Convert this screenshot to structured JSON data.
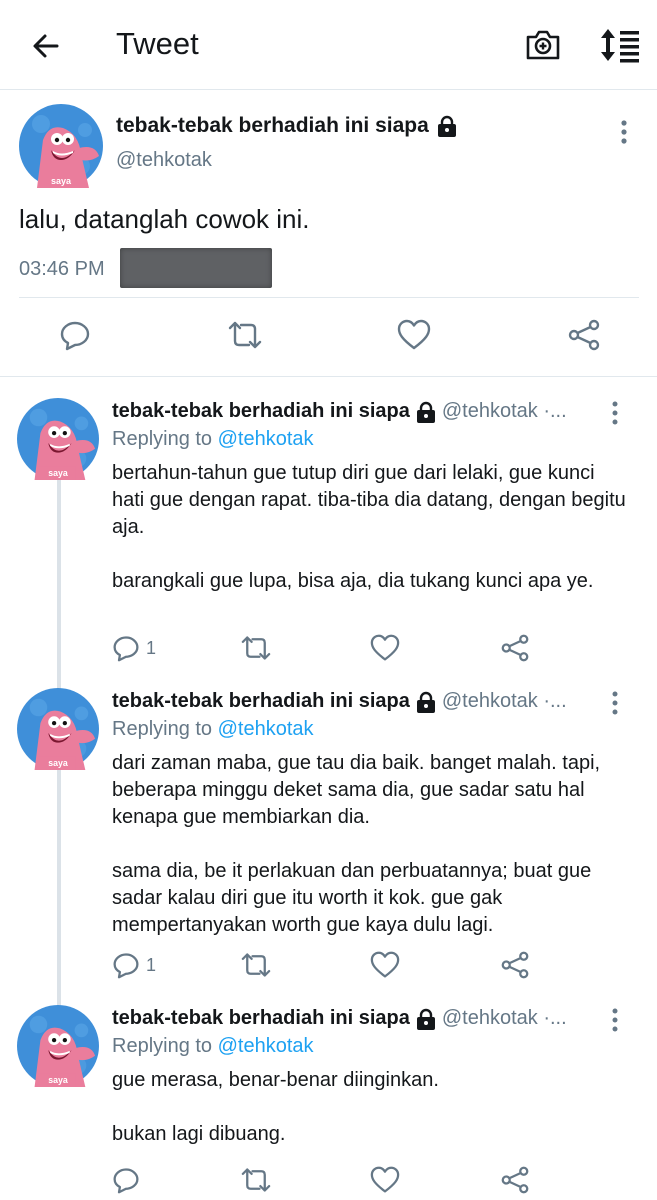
{
  "header": {
    "title": "Tweet",
    "back_icon": "arrow-left-icon",
    "camera_icon": "camera-plus-icon",
    "sort_icon": "sort-list-icon"
  },
  "main_tweet": {
    "display_name": "tebak-tebak berhadiah ini siapa",
    "handle": "@tehkotak",
    "text": "lalu, datanglah cowok ini.",
    "time": "03:46 PM",
    "avatar_caption": "saya"
  },
  "replies": [
    {
      "display_name": "tebak-tebak berhadiah ini siapa",
      "handle": "@tehkotak ·...",
      "replying_prefix": "Replying to",
      "replying_to": "@tehkotak",
      "avatar_caption": "saya",
      "paragraphs": [
        "bertahun-tahun gue tutup diri gue dari lelaki, gue kunci hati gue dengan rapat. tiba-tiba dia datang, dengan begitu aja.",
        "barangkali gue lupa, bisa aja, dia tukang kunci apa ye."
      ],
      "reply_count": "1"
    },
    {
      "display_name": "tebak-tebak berhadiah ini siapa",
      "handle": "@tehkotak ·...",
      "replying_prefix": "Replying to",
      "replying_to": "@tehkotak",
      "avatar_caption": "saya",
      "paragraphs": [
        "dari zaman maba, gue tau dia baik. banget malah. tapi, beberapa minggu deket sama dia, gue sadar satu hal kenapa gue membiarkan dia.",
        "sama dia, be it perlakuan dan perbuatannya; buat gue sadar kalau diri gue itu worth it kok. gue gak mempertanyakan worth gue kaya dulu lagi."
      ],
      "reply_count": "1"
    },
    {
      "display_name": "tebak-tebak berhadiah ini siapa",
      "handle": "@tehkotak ·...",
      "replying_prefix": "Replying to",
      "replying_to": "@tehkotak",
      "avatar_caption": "saya",
      "paragraphs": [
        "gue merasa, benar-benar diinginkan.",
        "bukan lagi dibuang."
      ],
      "reply_count": ""
    }
  ],
  "colors": {
    "accent": "#1da1f2",
    "secondary_text": "#657786",
    "icon": "#657786",
    "divider": "#e1e8ed",
    "avatar_bg": "#3d8fd6",
    "avatar_figure": "#e87a9a"
  }
}
